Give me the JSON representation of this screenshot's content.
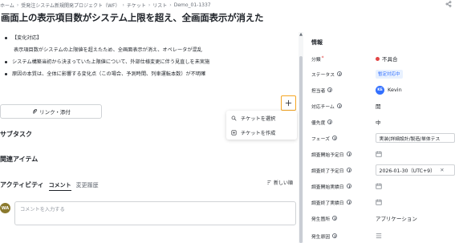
{
  "breadcrumb": [
    "ホーム",
    "受発注システム新規開発プロジェクト（WF）",
    "チケット",
    "リスト",
    "Demo_01-1337"
  ],
  "title": "画面上の表示項目数がシステム上限を超え、全画面表示が消えた",
  "description": {
    "heading": "【変化対応】",
    "line1": "表示項目数がシステムの上限値を超えたため、全画面表示が消え、オペレータが混乱",
    "bullet2": "システム構築当初から決まっていた上限値について、外部仕様変更に伴う見直しを未実施",
    "bullet3": "原因の本質は、全体に影響する変化点（この場合、予測時間、列車運転本数）が不明確"
  },
  "link_button": "リンク・添付",
  "subtask_label": "サブタスク",
  "related_label": "関連アイテム",
  "menu": {
    "select_ticket": "チケットを選択",
    "create_ticket": "チケットを作成"
  },
  "activity": {
    "title": "アクティビティ",
    "tab_comment": "コメント",
    "tab_history": "変更履歴",
    "sort": "新しい順"
  },
  "comment": {
    "avatar": "WA",
    "placeholder": "コメントを入力する"
  },
  "info": {
    "header": "情報",
    "category_label": "分類",
    "category_value": "不具合",
    "category_color": "#e24545",
    "status_label": "ステータス",
    "status_value": "暫定対応中",
    "assignee_label": "担当者",
    "assignee_avatar": "KE",
    "assignee_value": "Kevin",
    "team_label": "対応チーム",
    "team_value": "開",
    "priority_label": "優先度",
    "priority_value": "中",
    "phase_label": "フェーズ",
    "phase_value": "実装(詳細設計/製造/単体テス",
    "plan_start_label": "調査開始予定日",
    "plan_end_label": "調査終了予定日",
    "plan_end_value": "2026-01-30（UTC+9）",
    "actual_start_label": "調査開始実績日",
    "actual_end_label": "調査終了実績日",
    "location_label": "発生箇所",
    "location_value": "アプリケーション",
    "cause_label": "発生原因"
  }
}
